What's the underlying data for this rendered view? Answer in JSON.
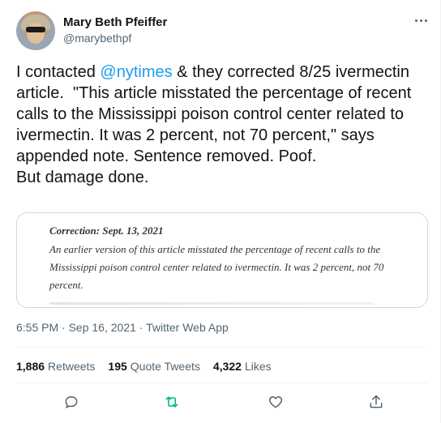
{
  "author": {
    "name": "Mary Beth Pfeiffer",
    "handle": "@marybethpf"
  },
  "tweet": {
    "text_before_mention": "I contacted ",
    "mention": "@nytimes",
    "text_after_mention": " & they corrected 8/25 ivermectin article.  \"This article misstated the percentage of recent calls to the Mississippi poison control center related to ivermectin. It was 2 percent, not 70 percent,\" says appended note. Sentence removed. Poof.\nBut damage done."
  },
  "quoted_image": {
    "title": "Correction: Sept. 13, 2021",
    "text": "An earlier version of this article misstated the percentage of recent calls to the Mississippi poison control center related to ivermectin. It was 2 percent, not 70 percent."
  },
  "meta": {
    "time": "6:55 PM",
    "separator1": " · ",
    "date": "Sep 16, 2021",
    "separator2": " · ",
    "client": "Twitter Web App"
  },
  "stats": {
    "retweets_count": "1,886",
    "retweets_label": "Retweets",
    "quotes_count": "195",
    "quotes_label": "Quote Tweets",
    "likes_count": "4,322",
    "likes_label": "Likes"
  },
  "colors": {
    "accent": "#1d9bf0",
    "retweet_green": "#00ba7c",
    "muted": "#536471"
  }
}
